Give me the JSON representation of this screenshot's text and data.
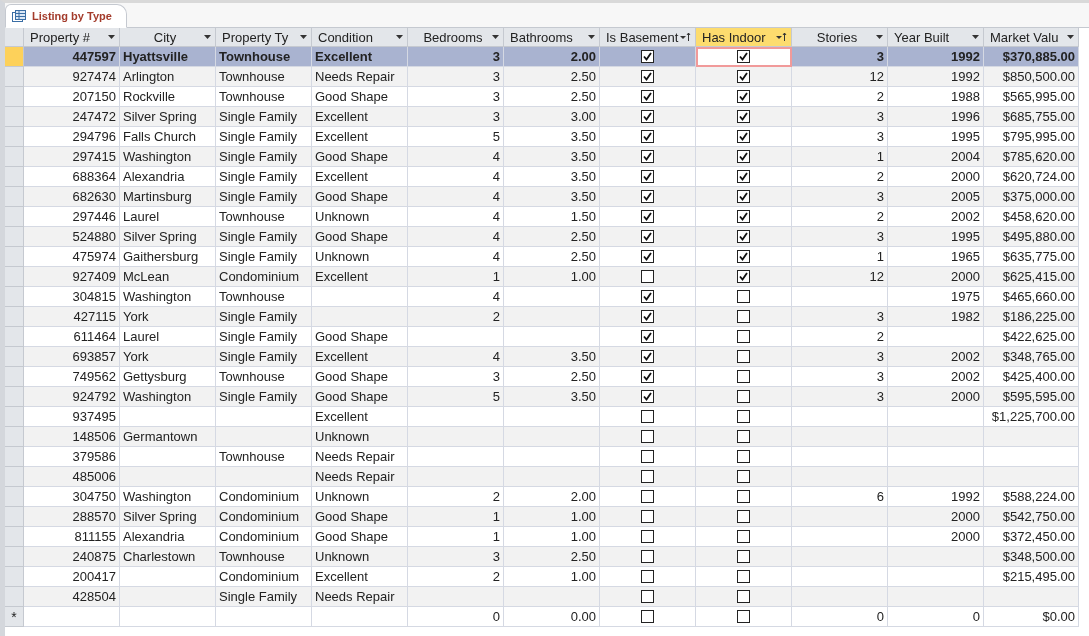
{
  "tab": {
    "title": "Listing by Type",
    "selected": true
  },
  "columns": [
    {
      "label": "Property #",
      "kind": "number",
      "sorted": false,
      "selected": false
    },
    {
      "label": "City",
      "kind": "text",
      "sorted": false,
      "selected": false
    },
    {
      "label": "Property Ty",
      "kind": "text",
      "sorted": false,
      "selected": false
    },
    {
      "label": "Condition",
      "kind": "text",
      "sorted": false,
      "selected": false
    },
    {
      "label": "Bedrooms",
      "kind": "number",
      "sorted": false,
      "selected": false
    },
    {
      "label": "Bathrooms",
      "kind": "number",
      "sorted": false,
      "selected": false
    },
    {
      "label": "Is Basement",
      "kind": "check",
      "sorted": true,
      "selected": false
    },
    {
      "label": "Has Indoor",
      "kind": "check",
      "sorted": true,
      "selected": true
    },
    {
      "label": "Stories",
      "kind": "number",
      "sorted": false,
      "selected": false
    },
    {
      "label": "Year Built",
      "kind": "number",
      "sorted": false,
      "selected": false
    },
    {
      "label": "Market Valu",
      "kind": "number",
      "sorted": false,
      "selected": false
    }
  ],
  "rows": [
    {
      "selected": true,
      "cells": [
        "447597",
        "Hyattsville",
        "Townhouse",
        "Excellent",
        "3",
        "2.00",
        true,
        true,
        "3",
        "1992",
        "$370,885.00"
      ]
    },
    {
      "selected": false,
      "cells": [
        "927474",
        "Arlington",
        "Townhouse",
        "Needs Repair",
        "3",
        "2.50",
        true,
        true,
        "12",
        "1992",
        "$850,500.00"
      ]
    },
    {
      "selected": false,
      "cells": [
        "207150",
        "Rockville",
        "Townhouse",
        "Good Shape",
        "3",
        "2.50",
        true,
        true,
        "2",
        "1988",
        "$565,995.00"
      ]
    },
    {
      "selected": false,
      "cells": [
        "247472",
        "Silver Spring",
        "Single Family",
        "Excellent",
        "3",
        "3.00",
        true,
        true,
        "3",
        "1996",
        "$685,755.00"
      ]
    },
    {
      "selected": false,
      "cells": [
        "294796",
        "Falls Church",
        "Single Family",
        "Excellent",
        "5",
        "3.50",
        true,
        true,
        "3",
        "1995",
        "$795,995.00"
      ]
    },
    {
      "selected": false,
      "cells": [
        "297415",
        "Washington",
        "Single Family",
        "Good Shape",
        "4",
        "3.50",
        true,
        true,
        "1",
        "2004",
        "$785,620.00"
      ]
    },
    {
      "selected": false,
      "cells": [
        "688364",
        "Alexandria",
        "Single Family",
        "Excellent",
        "4",
        "3.50",
        true,
        true,
        "2",
        "2000",
        "$620,724.00"
      ]
    },
    {
      "selected": false,
      "cells": [
        "682630",
        "Martinsburg",
        "Single Family",
        "Good Shape",
        "4",
        "3.50",
        true,
        true,
        "3",
        "2005",
        "$375,000.00"
      ]
    },
    {
      "selected": false,
      "cells": [
        "297446",
        "Laurel",
        "Townhouse",
        "Unknown",
        "4",
        "1.50",
        true,
        true,
        "2",
        "2002",
        "$458,620.00"
      ]
    },
    {
      "selected": false,
      "cells": [
        "524880",
        "Silver Spring",
        "Single Family",
        "Good Shape",
        "4",
        "2.50",
        true,
        true,
        "3",
        "1995",
        "$495,880.00"
      ]
    },
    {
      "selected": false,
      "cells": [
        "475974",
        "Gaithersburg",
        "Single Family",
        "Unknown",
        "4",
        "2.50",
        true,
        true,
        "1",
        "1965",
        "$635,775.00"
      ]
    },
    {
      "selected": false,
      "cells": [
        "927409",
        "McLean",
        "Condominium",
        "Excellent",
        "1",
        "1.00",
        false,
        true,
        "12",
        "2000",
        "$625,415.00"
      ]
    },
    {
      "selected": false,
      "cells": [
        "304815",
        "Washington",
        "Townhouse",
        null,
        "4",
        null,
        true,
        false,
        null,
        "1975",
        "$465,660.00"
      ]
    },
    {
      "selected": false,
      "cells": [
        "427115",
        "York",
        "Single Family",
        null,
        "2",
        null,
        true,
        false,
        "3",
        "1982",
        "$186,225.00"
      ]
    },
    {
      "selected": false,
      "cells": [
        "611464",
        "Laurel",
        "Single Family",
        "Good Shape",
        null,
        null,
        true,
        false,
        "2",
        null,
        "$422,625.00"
      ]
    },
    {
      "selected": false,
      "cells": [
        "693857",
        "York",
        "Single Family",
        "Excellent",
        "4",
        "3.50",
        true,
        false,
        "3",
        "2002",
        "$348,765.00"
      ]
    },
    {
      "selected": false,
      "cells": [
        "749562",
        "Gettysburg",
        "Townhouse",
        "Good Shape",
        "3",
        "2.50",
        true,
        false,
        "3",
        "2002",
        "$425,400.00"
      ]
    },
    {
      "selected": false,
      "cells": [
        "924792",
        "Washington",
        "Single Family",
        "Good Shape",
        "5",
        "3.50",
        true,
        false,
        "3",
        "2000",
        "$595,595.00"
      ]
    },
    {
      "selected": false,
      "cells": [
        "937495",
        null,
        null,
        "Excellent",
        null,
        null,
        false,
        false,
        null,
        null,
        "$1,225,700.00"
      ]
    },
    {
      "selected": false,
      "cells": [
        "148506",
        "Germantown",
        null,
        "Unknown",
        null,
        null,
        false,
        false,
        null,
        null,
        null
      ]
    },
    {
      "selected": false,
      "cells": [
        "379586",
        null,
        "Townhouse",
        "Needs Repair",
        null,
        null,
        false,
        false,
        null,
        null,
        null
      ]
    },
    {
      "selected": false,
      "cells": [
        "485006",
        null,
        null,
        "Needs Repair",
        null,
        null,
        false,
        false,
        null,
        null,
        null
      ]
    },
    {
      "selected": false,
      "cells": [
        "304750",
        "Washington",
        "Condominium",
        "Unknown",
        "2",
        "2.00",
        false,
        false,
        "6",
        "1992",
        "$588,224.00"
      ]
    },
    {
      "selected": false,
      "cells": [
        "288570",
        "Silver Spring",
        "Condominium",
        "Good Shape",
        "1",
        "1.00",
        false,
        false,
        null,
        "2000",
        "$542,750.00"
      ]
    },
    {
      "selected": false,
      "cells": [
        "811155",
        "Alexandria",
        "Condominium",
        "Good Shape",
        "1",
        "1.00",
        false,
        false,
        null,
        "2000",
        "$372,450.00"
      ]
    },
    {
      "selected": false,
      "cells": [
        "240875",
        "Charlestown",
        "Townhouse",
        "Unknown",
        "3",
        "2.50",
        false,
        false,
        null,
        null,
        "$348,500.00"
      ]
    },
    {
      "selected": false,
      "cells": [
        "200417",
        null,
        "Condominium",
        "Excellent",
        "2",
        "1.00",
        false,
        false,
        null,
        null,
        "$215,495.00"
      ]
    },
    {
      "selected": false,
      "cells": [
        "428504",
        null,
        "Single Family",
        "Needs Repair",
        null,
        null,
        false,
        false,
        null,
        null,
        null
      ]
    }
  ],
  "new_record": {
    "marker": "*",
    "cells": [
      null,
      null,
      null,
      null,
      "0",
      "0.00",
      false,
      false,
      "0",
      "0",
      "$0.00"
    ]
  }
}
